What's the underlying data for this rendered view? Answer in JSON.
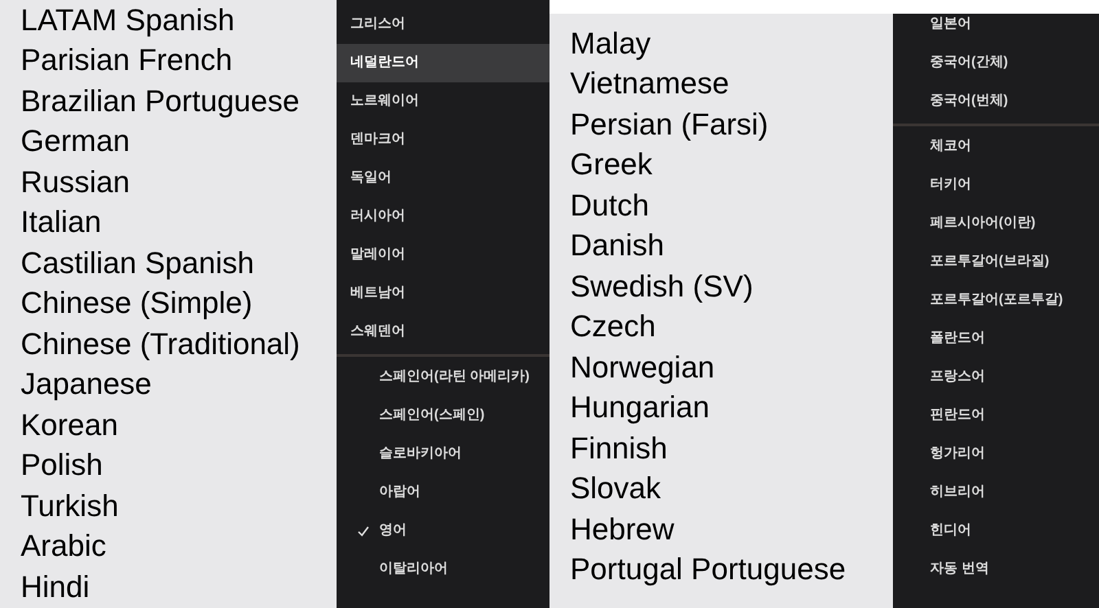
{
  "panels": [
    {
      "kind": "list",
      "items": [
        "LATAM Spanish",
        "Parisian French",
        "Brazilian Portuguese",
        "German",
        "Russian",
        "Italian",
        "Castilian Spanish",
        "Chinese (Simple)",
        "Chinese (Traditional)",
        "Japanese",
        "Korean",
        "Polish",
        "Turkish",
        "Arabic",
        "Hindi"
      ]
    },
    {
      "kind": "menu",
      "groups": [
        [
          {
            "label": "그리스어",
            "selected": false
          },
          {
            "label": "네덜란드어",
            "selected": true
          },
          {
            "label": "노르웨이어",
            "selected": false
          },
          {
            "label": "덴마크어",
            "selected": false
          },
          {
            "label": "독일어",
            "selected": false
          },
          {
            "label": "러시아어",
            "selected": false
          },
          {
            "label": "말레이어",
            "selected": false
          },
          {
            "label": "베트남어",
            "selected": false
          },
          {
            "label": "스웨덴어",
            "selected": false
          }
        ],
        [
          {
            "label": "스페인어(라틴 아메리카)",
            "selected": false,
            "checked": false
          },
          {
            "label": "스페인어(스페인)",
            "selected": false,
            "checked": false
          },
          {
            "label": "슬로바키아어",
            "selected": false,
            "checked": false
          },
          {
            "label": "아랍어",
            "selected": false,
            "checked": false
          },
          {
            "label": "영어",
            "selected": false,
            "checked": true
          },
          {
            "label": "이탈리아어",
            "selected": false,
            "checked": false
          }
        ]
      ]
    },
    {
      "kind": "list",
      "items": [
        "Malay",
        "Vietnamese",
        "Persian (Farsi)",
        "Greek",
        "Dutch",
        "Danish",
        "Swedish (SV)",
        "Czech",
        "Norwegian",
        "Hungarian",
        "Finnish",
        "Slovak",
        "Hebrew",
        "Portugal Portuguese"
      ]
    },
    {
      "kind": "menu",
      "groups": [
        [
          {
            "label": "일본어",
            "selected": false
          },
          {
            "label": "중국어(간체)",
            "selected": false
          },
          {
            "label": "중국어(번체)",
            "selected": false
          }
        ],
        [
          {
            "label": "체코어",
            "selected": false
          },
          {
            "label": "터키어",
            "selected": false
          },
          {
            "label": "페르시아어(이란)",
            "selected": false
          },
          {
            "label": "포르투갈어(브라질)",
            "selected": false
          },
          {
            "label": "포르투갈어(포르투갈)",
            "selected": false
          },
          {
            "label": "폴란드어",
            "selected": false
          },
          {
            "label": "프랑스어",
            "selected": false
          },
          {
            "label": "핀란드어",
            "selected": false
          },
          {
            "label": "헝가리어",
            "selected": false
          },
          {
            "label": "히브리어",
            "selected": false
          },
          {
            "label": "힌디어",
            "selected": false
          },
          {
            "label": "자동 번역",
            "selected": false
          }
        ]
      ]
    }
  ]
}
